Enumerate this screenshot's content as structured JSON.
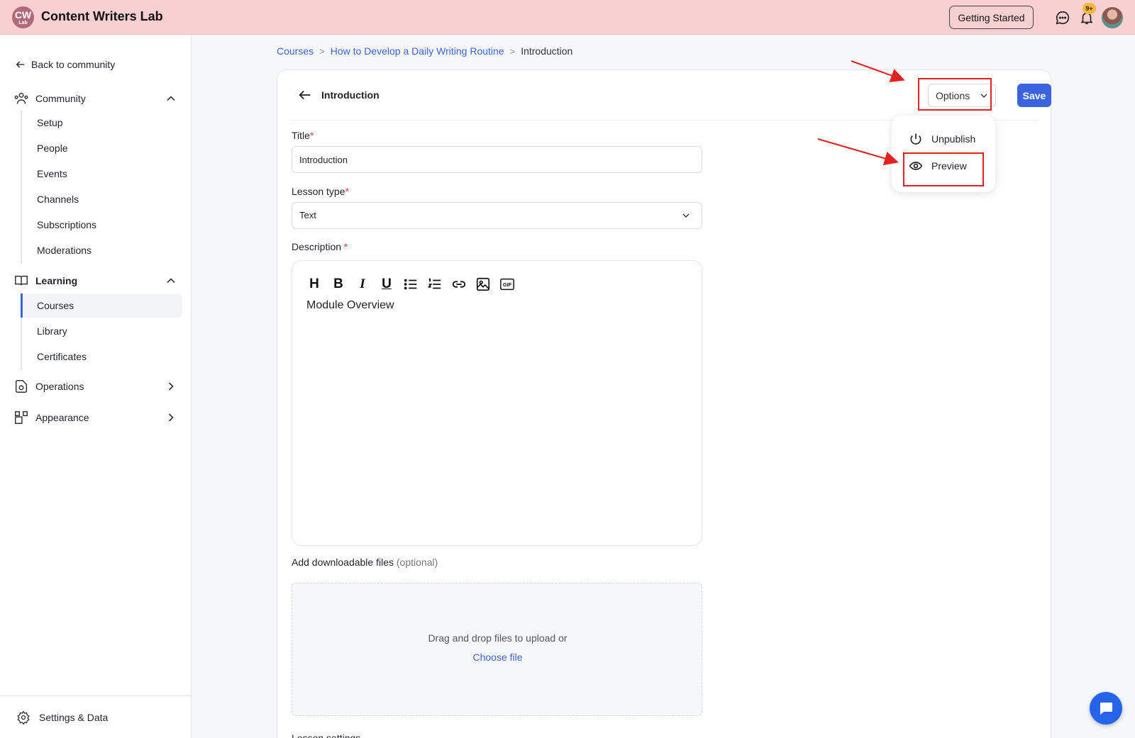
{
  "app": {
    "logo_text": "CW",
    "logo_sub": "Lab",
    "title": "Content Writers Lab",
    "getting_started_label": "Getting Started",
    "notification_count": "9+"
  },
  "sidebar": {
    "back_label": "Back to community",
    "community": {
      "label": "Community",
      "items": [
        "Setup",
        "People",
        "Events",
        "Channels",
        "Subscriptions",
        "Moderations"
      ]
    },
    "learning": {
      "label": "Learning",
      "items": [
        "Courses",
        "Library",
        "Certificates"
      ],
      "active": "Courses"
    },
    "operations_label": "Operations",
    "appearance_label": "Appearance",
    "settings_label": "Settings & Data"
  },
  "breadcrumb": {
    "items": [
      "Courses",
      "How to Develop a Daily Writing Routine",
      "Introduction"
    ]
  },
  "editor": {
    "header_title": "Introduction",
    "options_label": "Options",
    "save_label": "Save",
    "title_label": "Title",
    "title_value": "Introduction",
    "lesson_type_label": "Lesson type",
    "lesson_type_value": "Text",
    "description_label": "Description",
    "description_content": "Module Overview",
    "toolbar_icons": [
      "heading-icon",
      "bold-icon",
      "italic-icon",
      "underline-icon",
      "bullet-list-icon",
      "numbered-list-icon",
      "link-icon",
      "image-icon",
      "gif-icon"
    ],
    "files_label": "Add downloadable files",
    "files_optional": "(optional)",
    "dropzone_text": "Drag and drop files to upload or",
    "choose_file_label": "Choose file",
    "lesson_settings_label": "Lesson settings"
  },
  "options_menu": {
    "items": [
      "Unpublish",
      "Preview"
    ]
  },
  "colors": {
    "topbar": "#f6cfd1",
    "accent": "#3b63e0",
    "annotation": "#e32121"
  }
}
